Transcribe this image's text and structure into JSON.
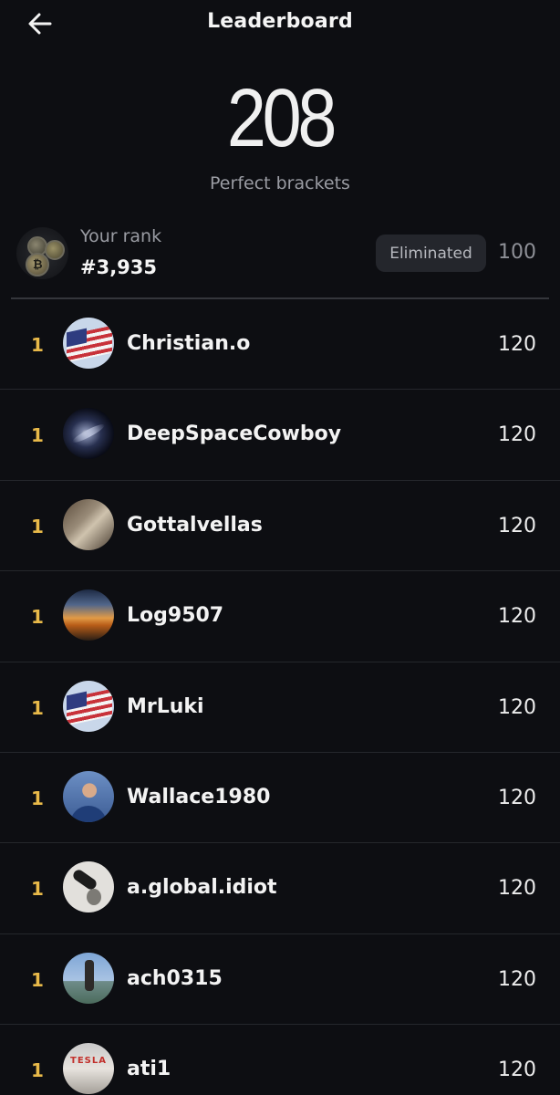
{
  "header": {
    "title": "Leaderboard",
    "back_icon": "arrow-left-icon"
  },
  "summary": {
    "count": "208",
    "count_label": "Perfect brackets"
  },
  "my_rank": {
    "label": "Your rank",
    "rank": "#3,935",
    "status": "Eliminated",
    "score": "100",
    "avatar": "crypto-coins-avatar"
  },
  "colors": {
    "background": "#0d0e12",
    "rank_gold": "#e8b949",
    "muted_text": "#9a9ca3",
    "badge_bg": "#24262c"
  },
  "leaderboard": [
    {
      "rank": "1",
      "name": "Christian.o",
      "score": "120",
      "avatar": "us-flag-avatar"
    },
    {
      "rank": "1",
      "name": "DeepSpaceCowboy",
      "score": "120",
      "avatar": "galaxy-avatar"
    },
    {
      "rank": "1",
      "name": "Gottalvellas",
      "score": "120",
      "avatar": "sepia-photo-avatar"
    },
    {
      "rank": "1",
      "name": "Log9507",
      "score": "120",
      "avatar": "sunset-avatar"
    },
    {
      "rank": "1",
      "name": "MrLuki",
      "score": "120",
      "avatar": "us-flag-avatar"
    },
    {
      "rank": "1",
      "name": "Wallace1980",
      "score": "120",
      "avatar": "person-photo-avatar"
    },
    {
      "rank": "1",
      "name": "a.global.idiot",
      "score": "120",
      "avatar": "sketch-avatar"
    },
    {
      "rank": "1",
      "name": "ach0315",
      "score": "120",
      "avatar": "statue-photo-avatar"
    },
    {
      "rank": "1",
      "name": "ati1",
      "score": "120",
      "avatar": "tesla-sign-avatar"
    }
  ]
}
